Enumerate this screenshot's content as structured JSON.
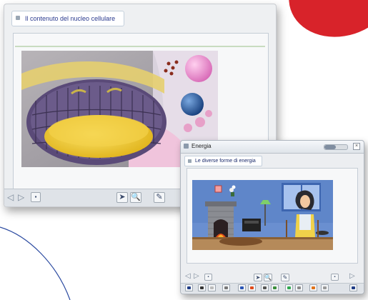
{
  "colors": {
    "accent_red": "#d8232a",
    "title_blue": "#2b3b8f",
    "frame_green": "#c8dcc0"
  },
  "window_main": {
    "tab_title": "Il contenuto del nucleo cellulare",
    "icons": [
      "tab-bullet-icon",
      "nav-back-icon",
      "nav-forward-icon",
      "page-icon",
      "pointer-icon",
      "zoom-icon",
      "highlight-icon"
    ]
  },
  "window_energy": {
    "title": "Energia",
    "subtab_title": "Le diverse forme di energia",
    "zoom_level_fraction": 0.5,
    "icons": [
      "window-icon",
      "close-icon",
      "nav-back-icon",
      "nav-forward-icon",
      "page-icon",
      "pointer-icon",
      "zoom-icon",
      "highlight-icon",
      "speaker-icon"
    ]
  }
}
